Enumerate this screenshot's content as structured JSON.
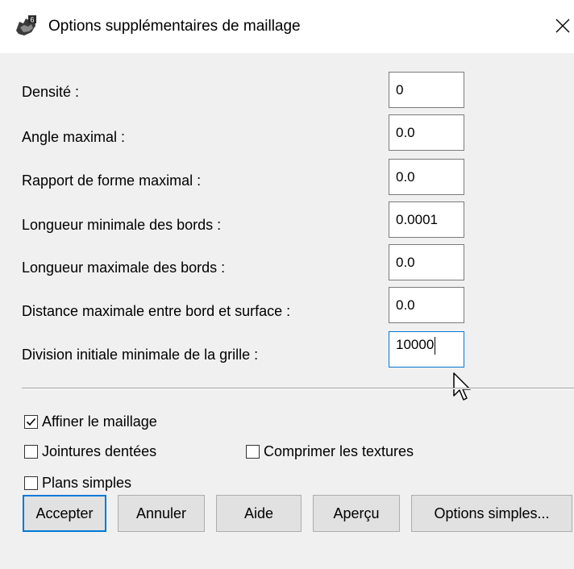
{
  "window": {
    "title": "Options supplémentaires de maillage",
    "app_icon": "rhino-app-icon",
    "close_icon": "close-icon"
  },
  "fields": [
    {
      "label": "Densité :",
      "value": "0"
    },
    {
      "label": "Angle maximal :",
      "value": "0.0"
    },
    {
      "label": "Rapport de forme maximal :",
      "value": "0.0"
    },
    {
      "label": "Longueur minimale des bords :",
      "value": "0.0001"
    },
    {
      "label": "Longueur maximale des bords :",
      "value": "0.0"
    },
    {
      "label": "Distance maximale entre bord et surface :",
      "value": "0.0"
    },
    {
      "label": "Division initiale minimale de la grille :",
      "value": "10000"
    }
  ],
  "checkboxes": {
    "refine": {
      "label": "Affiner le maillage",
      "checked": true
    },
    "jagged": {
      "label": "Jointures dentées",
      "checked": false
    },
    "compress": {
      "label": "Comprimer les textures",
      "checked": false
    },
    "simple_planes": {
      "label": "Plans simples",
      "checked": false
    }
  },
  "buttons": {
    "accept": "Accepter",
    "cancel": "Annuler",
    "help": "Aide",
    "preview": "Aperçu",
    "simple_options": "Options simples..."
  },
  "colors": {
    "accent": "#0078d7",
    "dialog_bg": "#f0f0f0",
    "button_bg": "#e1e1e1"
  }
}
